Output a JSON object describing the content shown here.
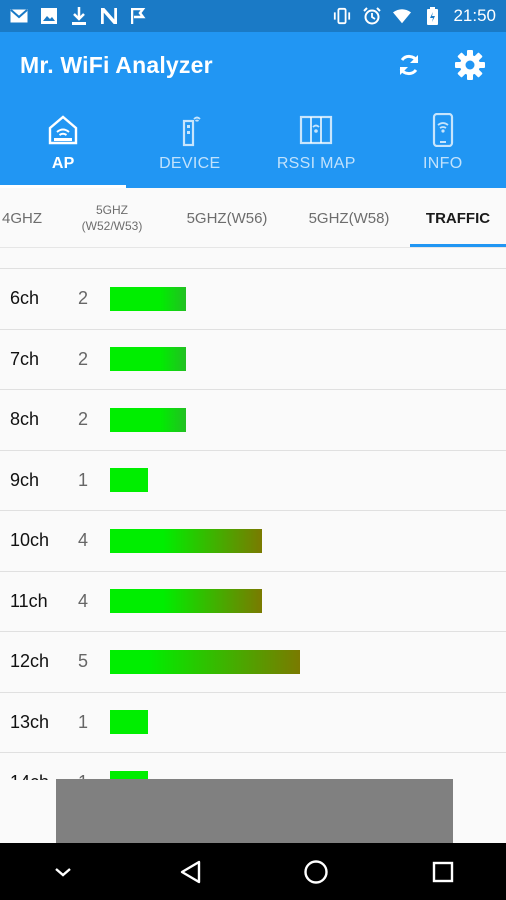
{
  "status_bar": {
    "time": "21:50",
    "left_icons": [
      "mail-icon",
      "image-icon",
      "download-icon",
      "n-icon",
      "flag-icon"
    ],
    "right_icons": [
      "vibrate-icon",
      "alarm-icon",
      "wifi-icon",
      "battery-icon"
    ]
  },
  "app_bar": {
    "title": "Mr. WiFi Analyzer",
    "actions": [
      "refresh-icon",
      "settings-icon"
    ]
  },
  "tabs": [
    {
      "label": "AP",
      "icon": "router-icon",
      "active": true
    },
    {
      "label": "DEVICE",
      "icon": "device-icon",
      "active": false
    },
    {
      "label": "RSSI MAP",
      "icon": "map-icon",
      "active": false
    },
    {
      "label": "INFO",
      "icon": "phone-info-icon",
      "active": false
    }
  ],
  "band_tabs": [
    {
      "label": "4GHZ",
      "active": false
    },
    {
      "label": "5GHZ",
      "sub": "(W52/W53)",
      "active": false
    },
    {
      "label": "5GHZ(W56)",
      "active": false
    },
    {
      "label": "5GHZ(W58)",
      "active": false
    },
    {
      "label": "TRAFFIC",
      "active": true
    }
  ],
  "traffic": {
    "rows": [
      {
        "channel": "6ch",
        "count": "2"
      },
      {
        "channel": "7ch",
        "count": "2"
      },
      {
        "channel": "8ch",
        "count": "2"
      },
      {
        "channel": "9ch",
        "count": "1"
      },
      {
        "channel": "10ch",
        "count": "4"
      },
      {
        "channel": "11ch",
        "count": "4"
      },
      {
        "channel": "12ch",
        "count": "5"
      },
      {
        "channel": "13ch",
        "count": "1"
      },
      {
        "channel": "14ch",
        "count": "1"
      }
    ],
    "colors": {
      "low": "#00ee00",
      "high": "#7a7a00"
    }
  },
  "nav_bar": {
    "buttons": [
      "chevron-down-icon",
      "back-icon",
      "home-icon",
      "recents-icon"
    ]
  }
}
